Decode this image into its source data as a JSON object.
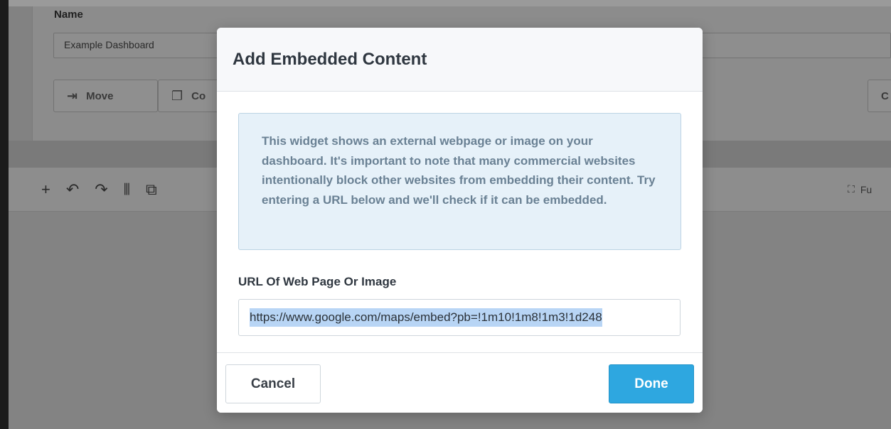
{
  "background": {
    "name_label": "Name",
    "name_value": "Example Dashboard",
    "move_label": "Move",
    "copy_label": "Co",
    "right_button_label": "C",
    "fullscreen_label": "Fu"
  },
  "modal": {
    "title": "Add Embedded Content",
    "info_text": "This widget shows an external webpage or image on your dashboard. It's important to note that many commercial websites intentionally block other websites from embedding their content. Try entering a URL below and we'll check if it can be embedded.",
    "url_label": "URL Of Web Page Or Image",
    "url_value": "https://www.google.com/maps/embed?pb=!1m10!1m8!1m3!1d248",
    "cancel_label": "Cancel",
    "done_label": "Done"
  },
  "colors": {
    "primary": "#2ea7e0",
    "info_bg": "#e6f1f9",
    "info_text": "#6a8194"
  }
}
